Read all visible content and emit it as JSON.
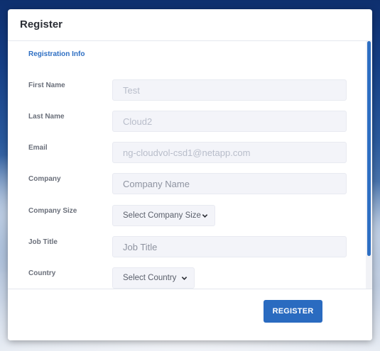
{
  "modal": {
    "title": "Register"
  },
  "section": {
    "title": "Registration Info"
  },
  "fields": {
    "first_name": {
      "label": "First Name",
      "value": "Test"
    },
    "last_name": {
      "label": "Last Name",
      "value": "Cloud2"
    },
    "email": {
      "label": "Email",
      "value": "ng-cloudvol-csd1@netapp.com"
    },
    "company": {
      "label": "Company",
      "placeholder": "Company Name"
    },
    "company_size": {
      "label": "Company Size",
      "selected": "Select Company Size"
    },
    "job_title": {
      "label": "Job Title",
      "placeholder": "Job Title"
    },
    "country": {
      "label": "Country",
      "selected": "Select Country"
    }
  },
  "footer": {
    "register_label": "REGISTER"
  },
  "icons": {
    "dropdown": "chevron-down-icon"
  },
  "colors": {
    "accent": "#2a6bc0",
    "section_title": "#2e6fc3"
  }
}
